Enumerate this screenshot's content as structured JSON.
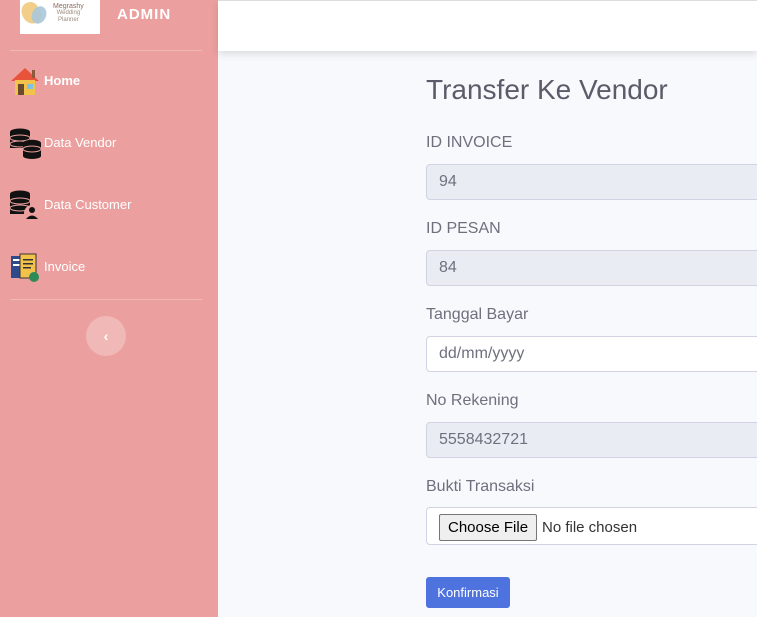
{
  "sidebar": {
    "brand": {
      "logo_line1": "Megrashy",
      "logo_line2": "Wedding",
      "logo_line3": "Planner",
      "title": "ADMIN"
    },
    "items": [
      {
        "label": "Home",
        "icon": "house-icon",
        "active": true
      },
      {
        "label": "Data Vendor",
        "icon": "database-icon"
      },
      {
        "label": "Data Customer",
        "icon": "database-user-icon"
      },
      {
        "label": "Invoice",
        "icon": "invoice-document-icon"
      }
    ],
    "toggle_icon": "chevron-left-icon",
    "toggle_glyph": "‹",
    "color": "#eba09f"
  },
  "form": {
    "title": "Transfer Ke Vendor",
    "id_invoice": {
      "label": "ID INVOICE",
      "value": "94"
    },
    "id_pesan": {
      "label": "ID PESAN",
      "value": "84"
    },
    "tanggal_bayar": {
      "label": "Tanggal Bayar",
      "placeholder": "dd/mm/yyyy"
    },
    "no_rekening": {
      "label": "No Rekening",
      "value": "5558432721"
    },
    "bukti_transaksi": {
      "label": "Bukti Transaksi",
      "button": "Choose File",
      "status": "No file chosen"
    },
    "submit_label": "Konfirmasi",
    "accent": "#4e73df"
  }
}
